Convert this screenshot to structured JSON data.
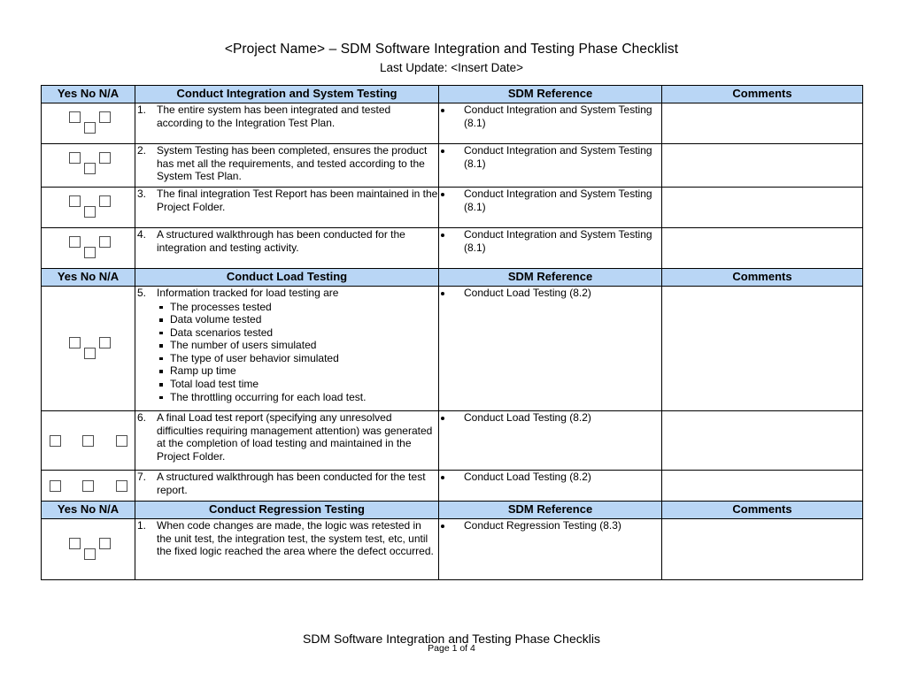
{
  "document": {
    "title": "<Project Name> – SDM Software Integration and Testing Phase Checklist",
    "subtitle": "Last Update: <Insert Date>"
  },
  "columns": {
    "check": "Yes No N/A",
    "sdm": "SDM Reference",
    "comments": "Comments"
  },
  "sections": [
    {
      "heading": "Conduct Integration and System Testing",
      "rows": [
        {
          "num": "1.",
          "text": "The entire system has been integrated and tested according to the Integration Test Plan.",
          "sdm": "Conduct Integration and System Testing (8.1)",
          "comment": "",
          "checkbox_style": "triangle"
        },
        {
          "num": "2.",
          "text": "System Testing has been completed, ensures the product has met all the requirements, and tested according to the System Test Plan.",
          "sdm": "Conduct Integration and System Testing (8.1)",
          "comment": "",
          "checkbox_style": "triangle"
        },
        {
          "num": "3.",
          "text": "The final integration Test Report has been maintained in the Project Folder.",
          "sdm": "Conduct Integration and System Testing (8.1)",
          "comment": "",
          "checkbox_style": "triangle"
        },
        {
          "num": "4.",
          "text": "A structured walkthrough has been conducted for the integration and testing activity.",
          "sdm": "Conduct Integration and System Testing (8.1)",
          "comment": "",
          "checkbox_style": "triangle"
        }
      ]
    },
    {
      "heading": "Conduct Load Testing",
      "rows": [
        {
          "num": "5.",
          "text": "Information tracked for load testing are",
          "bullets": [
            "The processes tested",
            "Data volume tested",
            "Data scenarios tested",
            "The number of users simulated",
            "The type of user behavior simulated",
            "Ramp up time",
            "Total load test time",
            "The throttling occurring for each load test."
          ],
          "sdm": "Conduct Load Testing (8.2)",
          "comment": "",
          "checkbox_style": "triangle"
        },
        {
          "num": "6.",
          "text": "A final Load test report (specifying any unresolved difficulties requiring management attention) was generated at the completion of load testing and maintained in the Project Folder.",
          "sdm": "Conduct Load Testing (8.2)",
          "comment": "",
          "checkbox_style": "row"
        },
        {
          "num": "7.",
          "text": "A structured walkthrough has been conducted for the test report.",
          "sdm": "Conduct Load Testing (8.2)",
          "comment": "",
          "checkbox_style": "row"
        }
      ]
    },
    {
      "heading": "Conduct Regression Testing",
      "rows": [
        {
          "num": "1.",
          "text": "When code changes are made, the logic was retested in the unit test, the integration test, the system test, etc, until the fixed logic reached the area where the defect occurred.",
          "sdm": "Conduct Regression Testing (8.3)",
          "comment": "",
          "checkbox_style": "triangle"
        }
      ]
    }
  ],
  "footer": {
    "title": "SDM Software Integration and Testing Phase Checklis",
    "page": "Page 1 of 4"
  },
  "colors": {
    "header_background": "#B9D6F5",
    "border": "#000000",
    "checkbox_border": "#4F4F4F",
    "page_background": "#FFFFFF"
  }
}
